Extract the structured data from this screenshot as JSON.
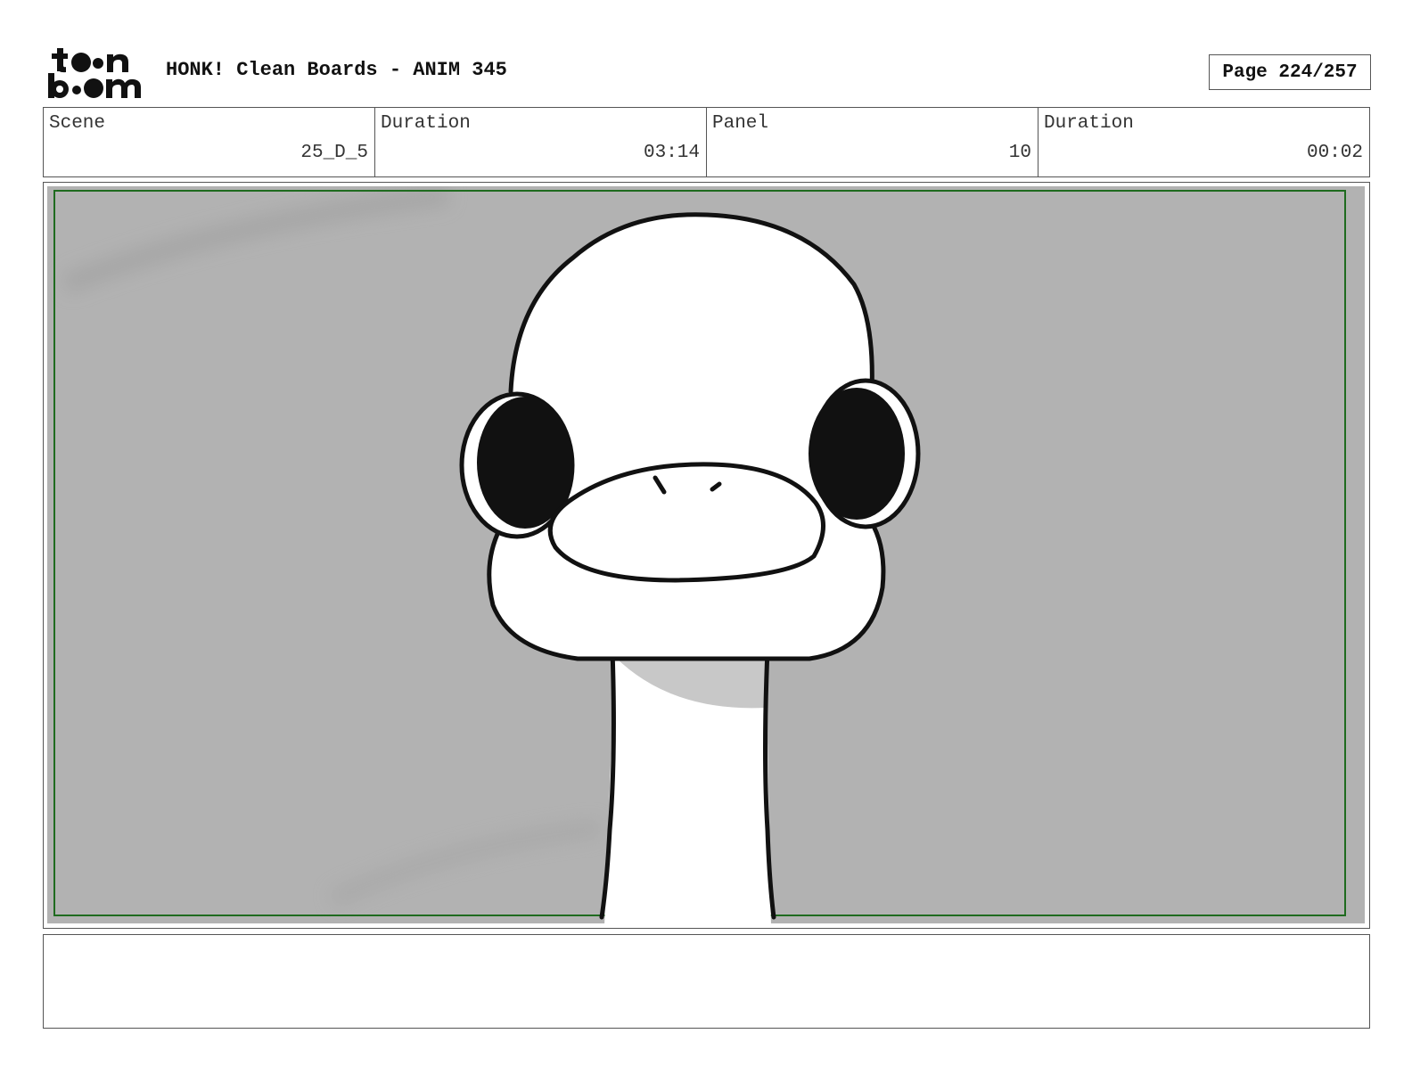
{
  "header": {
    "logo_text": "toon boom",
    "title": "HONK! Clean Boards - ANIM 345",
    "page": "Page 224/257"
  },
  "info": [
    {
      "label": "Scene",
      "value": "25_D_5"
    },
    {
      "label": "Duration",
      "value": "03:14"
    },
    {
      "label": "Panel",
      "value": "10"
    },
    {
      "label": "Duration",
      "value": "00:02"
    }
  ],
  "panel": {
    "frame_color": "#1f6b1f",
    "background_color": "#b2b2b2",
    "illustration": "goose-character"
  },
  "notes": {
    "text": ""
  }
}
